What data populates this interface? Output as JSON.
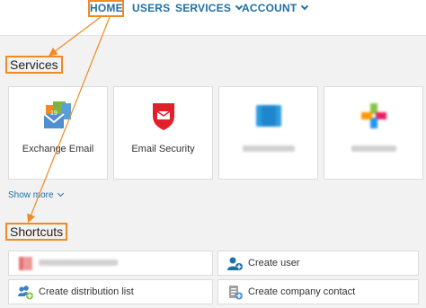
{
  "nav": {
    "items": [
      {
        "label": "HOME"
      },
      {
        "label": "USERS"
      },
      {
        "label": "SERVICES"
      },
      {
        "label": "ACCOUNT"
      }
    ]
  },
  "services": {
    "title": "Services",
    "cards": [
      {
        "label": "Exchange Email",
        "icon": "exchange-email-icon"
      },
      {
        "label": "Email Security",
        "icon": "email-security-shield-icon"
      },
      {
        "label": "",
        "icon": "blurred-service-icon"
      },
      {
        "label": "",
        "icon": "blurred-colorful-app-icon"
      }
    ],
    "show_more": "Show more"
  },
  "shortcuts": {
    "title": "Shortcuts",
    "items": [
      {
        "label": "",
        "icon": "blurred-red-icon"
      },
      {
        "label": "Create user",
        "icon": "add-user-icon"
      },
      {
        "label": "Create distribution list",
        "icon": "add-distribution-list-icon"
      },
      {
        "label": "Create company contact",
        "icon": "add-contact-icon"
      }
    ]
  },
  "colors": {
    "accent": "#1f6fa8",
    "highlight": "#f08a24",
    "background": "#f2f2f2"
  }
}
